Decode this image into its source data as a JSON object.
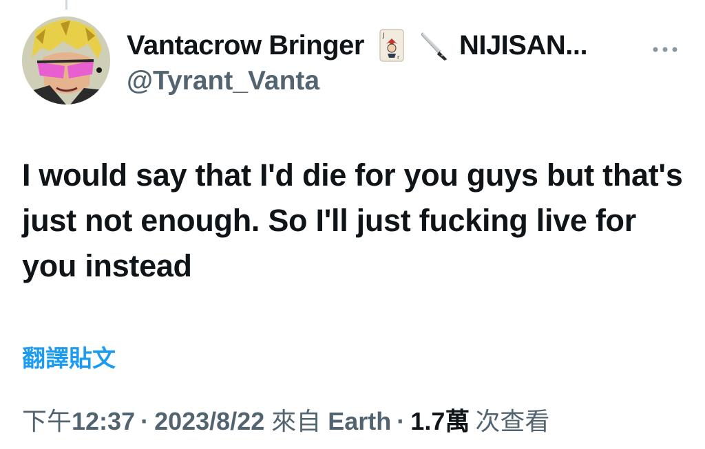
{
  "author": {
    "display_name": "Vantacrow Bringer",
    "name_emoji_1": "joker-card-icon",
    "name_emoji_2": "knife-icon",
    "name_suffix": "NIJISAN...",
    "handle": "@Tyrant_Vanta",
    "more_icon": "more-dots-icon"
  },
  "tweet": {
    "text": "I would say that I'd die for you guys but that's just not enough. So I'll just fucking live for you instead",
    "translate_label": "翻譯貼文"
  },
  "meta": {
    "time_prefix": "下午",
    "time": "12:37",
    "date": "2023/8/22",
    "source_prefix": "來自",
    "source": "Earth",
    "views_count": "1.7萬",
    "views_label": "次查看"
  },
  "colors": {
    "text": "#0f1419",
    "secondary": "#536471",
    "accent": "#1d9bf0"
  }
}
